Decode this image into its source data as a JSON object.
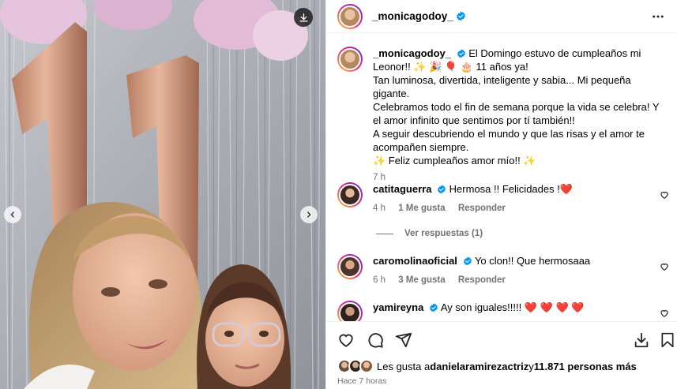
{
  "post": {
    "username": "_monicagodoy_",
    "colors": {
      "brand_blue": "#0095f6",
      "heart_red": "#ff3040",
      "muted": "#737373"
    }
  },
  "caption": {
    "username": "_monicagodoy_",
    "line1": "El Domingo estuvo de cumpleaños mi Leonor!! ✨ 🎉 🎈 🎂  11 años ya!",
    "line2": "Tan luminosa, divertida, inteligente y sabia... Mi pequeña gigante.",
    "line3": "Celebramos todo el fin de semana porque la vida se celebra! Y el amor infinito que sentimos por tí también!!",
    "line4": "A seguir descubriendo el mundo y que las risas y el amor te acompañen siempre.",
    "line5": "✨ Feliz cumpleaños amor mío!! ✨",
    "time": "7 h"
  },
  "comments": [
    {
      "username": "catitaguerra",
      "text": "Hermosa !! Felicidades !",
      "emoji": "❤️",
      "time": "4 h",
      "likes": "1 Me gusta",
      "reply": "Responder"
    },
    {
      "username": "caromolinaoficial",
      "text": "Yo clon!! Que hermosaaa",
      "time": "6 h",
      "likes": "3 Me gusta",
      "reply": "Responder"
    },
    {
      "username": "yamireyna",
      "text": "Ay son iguales!!!!! ",
      "emoji": "❤️ ❤️ ❤️ ❤️"
    }
  ],
  "replies_toggle": "Ver respuestas (1)",
  "likes_line": {
    "prefix": "Les gusta a ",
    "user": "danielaramirezactriz",
    "mid": " y ",
    "count": "11.871 personas más"
  },
  "time_ago": "Hace 7 horas",
  "icons": [
    "download-icon",
    "chevron-left-icon",
    "chevron-right-icon",
    "more-icon",
    "verified-icon",
    "heart-icon",
    "comment-icon",
    "share-icon",
    "save-icon",
    "bookmark-icon"
  ]
}
